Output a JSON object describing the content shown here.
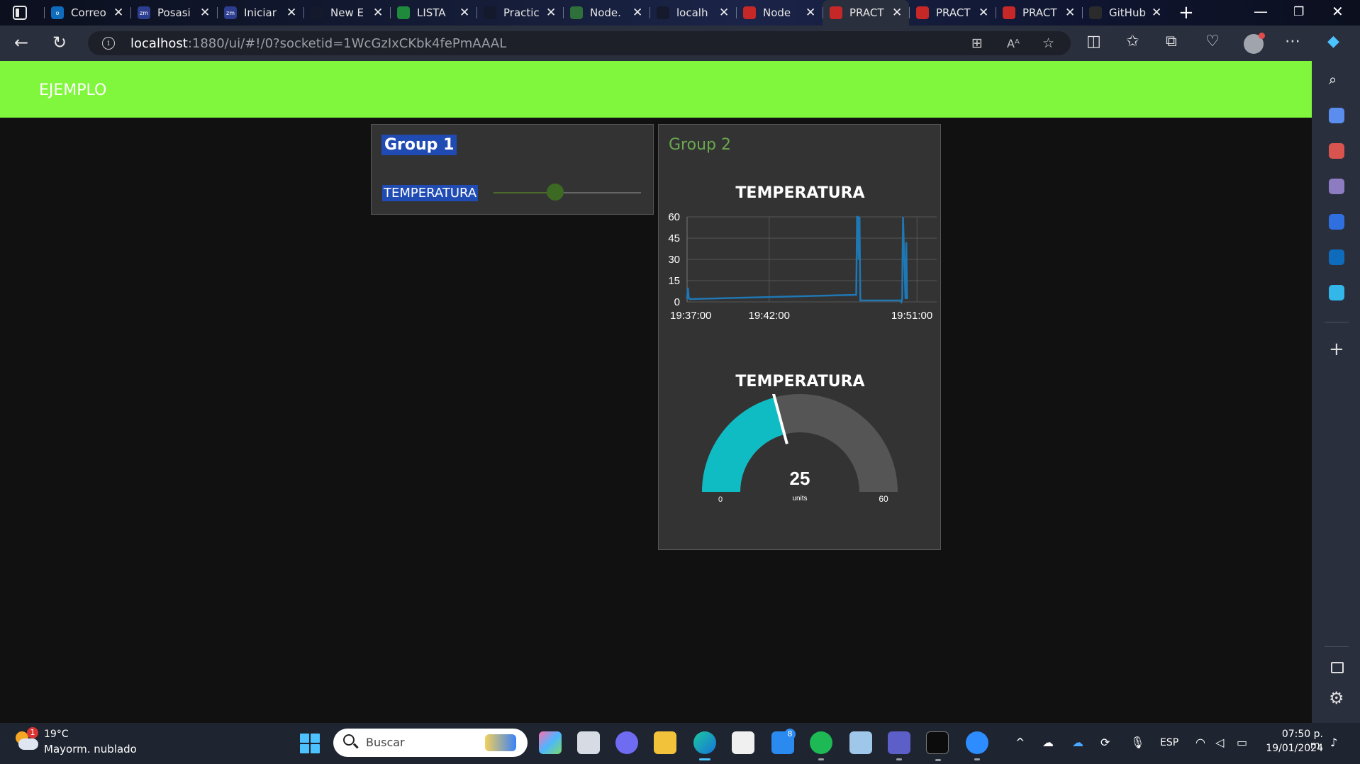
{
  "browser": {
    "tabs": [
      {
        "label": "Correo",
        "fav_color": "#0f6cbd",
        "fav_text": "o"
      },
      {
        "label": "Posasi",
        "fav_color": "#2d3d8f",
        "fav_text": "zm"
      },
      {
        "label": "Iniciar",
        "fav_color": "#2d3d8f",
        "fav_text": "zm"
      },
      {
        "label": "New E",
        "fav_color": "#14192c",
        "fav_text": ""
      },
      {
        "label": "LISTA",
        "fav_color": "#1f8a3b",
        "fav_text": ""
      },
      {
        "label": "Practic",
        "fav_color": "#14192c",
        "fav_text": ""
      },
      {
        "label": "Node.",
        "fav_color": "#2f6f3a",
        "fav_text": ""
      },
      {
        "label": "localh",
        "fav_color": "#14192c",
        "fav_text": ""
      },
      {
        "label": "Node",
        "fav_color": "#c62828",
        "fav_text": ""
      },
      {
        "label": "PRACT",
        "fav_color": "#c62828",
        "fav_text": ""
      },
      {
        "label": "PRACT",
        "fav_color": "#c62828",
        "fav_text": ""
      },
      {
        "label": "PRACT",
        "fav_color": "#c62828",
        "fav_text": ""
      },
      {
        "label": "GitHub",
        "fav_color": "#2b2b2b",
        "fav_text": ""
      }
    ],
    "active_tab_index": 9,
    "url_host": "localhost",
    "url_rest": ":1880/ui/#!/0?socketid=1WcGzIxCKbk4fePmAAAL"
  },
  "dashboard": {
    "title": "EJEMPLO",
    "header_color": "#80f73c",
    "group1": {
      "title": "Group 1",
      "slider_label": "TEMPERATURA",
      "slider_value": 25,
      "slider_max": 60
    },
    "group2": {
      "title": "Group 2",
      "chart_title": "TEMPERATURA",
      "gauge_title": "TEMPERATURA"
    }
  },
  "chart_data": [
    {
      "type": "line",
      "title": "TEMPERATURA",
      "series_color": "#1f77b4",
      "x_ticks": [
        "19:37:00",
        "19:42:00",
        "19:51:00"
      ],
      "x_tick_minutes": [
        0,
        5,
        14
      ],
      "xlim_minutes": [
        0,
        15.2
      ],
      "y_ticks": [
        0,
        15,
        30,
        45,
        60
      ],
      "ylim": [
        0,
        60
      ],
      "grid": true,
      "x_minutes": [
        0,
        0.05,
        0.1,
        0.15,
        10.3,
        10.32,
        10.35,
        10.4,
        10.45,
        10.5,
        10.55,
        10.6,
        13.0,
        13.05,
        13.1,
        13.12,
        13.15,
        13.3,
        13.35,
        13.4
      ],
      "values": [
        2,
        10,
        3,
        2,
        5,
        25,
        60,
        60,
        30,
        60,
        1,
        1,
        1,
        0,
        2,
        30,
        60,
        2,
        42,
        2
      ]
    },
    {
      "type": "gauge",
      "title": "TEMPERATURA",
      "value": 25,
      "min": 0,
      "max": 60,
      "units": "units",
      "min_label": "0",
      "max_label": "60",
      "fill_color": "#0fbcc4",
      "track_color": "#555555"
    }
  ],
  "taskbar": {
    "weather_temp": "19°C",
    "weather_desc": "Mayorm. nublado",
    "weather_badge": "1",
    "search_placeholder": "Buscar",
    "mail_badge": "8",
    "language": "ESP",
    "time": "07:50 p. m.",
    "date": "19/01/2024"
  }
}
